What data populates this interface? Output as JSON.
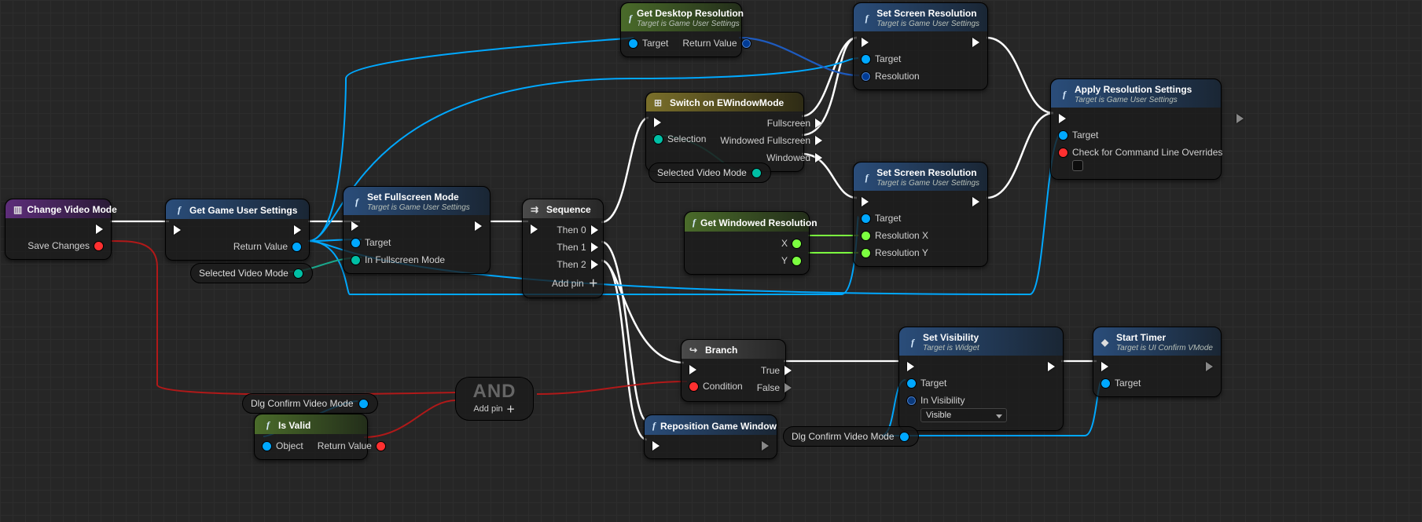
{
  "nodes": {
    "changeVideoMode": {
      "title": "Change Video Mode",
      "out_saveChanges": "Save Changes"
    },
    "getGameUserSettings": {
      "title": "Get Game User Settings",
      "out_returnValue": "Return Value"
    },
    "pill_selectedVideoMode1": {
      "label": "Selected Video Mode"
    },
    "setFullscreenMode": {
      "title": "Set Fullscreen Mode",
      "sub": "Target is Game User Settings",
      "in_target": "Target",
      "in_mode": "In Fullscreen Mode"
    },
    "sequence": {
      "title": "Sequence",
      "then0": "Then 0",
      "then1": "Then 1",
      "then2": "Then 2",
      "addPin": "Add pin"
    },
    "getDesktopResolution": {
      "title": "Get Desktop Resolution",
      "sub": "Target is Game User Settings",
      "in_target": "Target",
      "out_returnValue": "Return Value"
    },
    "switchWindowMode": {
      "title": "Switch on EWindowMode",
      "in_selection": "Selection",
      "out_fullscreen": "Fullscreen",
      "out_windowedFullscreen": "Windowed Fullscreen",
      "out_windowed": "Windowed"
    },
    "pill_selectedVideoMode2": {
      "label": "Selected Video Mode"
    },
    "getWindowedResolution": {
      "title": "Get Windowed Resolution",
      "out_x": "X",
      "out_y": "Y"
    },
    "setScreenRes1": {
      "title": "Set Screen Resolution",
      "sub": "Target is Game User Settings",
      "in_target": "Target",
      "in_resolution": "Resolution"
    },
    "setScreenRes2": {
      "title": "Set Screen Resolution",
      "sub": "Target is Game User Settings",
      "in_target": "Target",
      "in_resX": "Resolution X",
      "in_resY": "Resolution Y"
    },
    "applyResolution": {
      "title": "Apply Resolution Settings",
      "sub": "Target is Game User Settings",
      "in_target": "Target",
      "in_check": "Check for Command Line Overrides"
    },
    "repositionWindow": {
      "title": "Reposition Game Window"
    },
    "branch": {
      "title": "Branch",
      "in_condition": "Condition",
      "out_true": "True",
      "out_false": "False"
    },
    "pill_dlgConfirm1": {
      "label": "Dlg Confirm Video Mode"
    },
    "isValid": {
      "title": "Is Valid",
      "in_object": "Object",
      "out_returnValue": "Return Value"
    },
    "andNode": {
      "title": "AND",
      "addPin": "Add pin"
    },
    "setVisibility": {
      "title": "Set Visibility",
      "sub": "Target is Widget",
      "in_target": "Target",
      "in_visibility": "In Visibility",
      "visibility_value": "Visible"
    },
    "pill_dlgConfirm2": {
      "label": "Dlg Confirm Video Mode"
    },
    "startTimer": {
      "title": "Start Timer",
      "sub": "Target is UI Confirm VMode",
      "in_target": "Target"
    }
  }
}
